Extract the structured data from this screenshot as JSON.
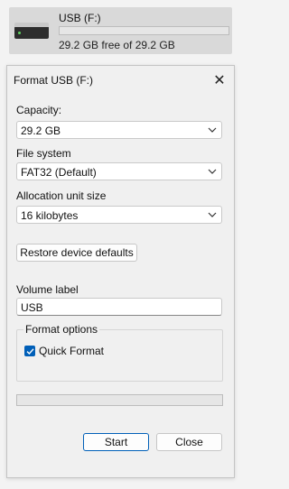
{
  "drive": {
    "name": "USB (F:)",
    "free_text": "29.2 GB free of 29.2 GB",
    "used_fraction": 0.0,
    "icon": "usb-drive-icon"
  },
  "dialog": {
    "title": "Format USB (F:)",
    "close_glyph": "✕",
    "capacity": {
      "label": "Capacity:",
      "value": "29.2 GB"
    },
    "file_system": {
      "label": "File system",
      "value": "FAT32 (Default)"
    },
    "allocation": {
      "label": "Allocation unit size",
      "value": "16 kilobytes"
    },
    "restore_label": "Restore device defaults",
    "volume": {
      "label": "Volume label",
      "value": "USB"
    },
    "format_options": {
      "legend": "Format options",
      "quick_format_label": "Quick Format",
      "quick_format_checked": true
    },
    "progress_fraction": 0.0,
    "start_label": "Start",
    "close_label": "Close"
  },
  "colors": {
    "accent": "#005fb8",
    "progress_green": "#06b025"
  }
}
